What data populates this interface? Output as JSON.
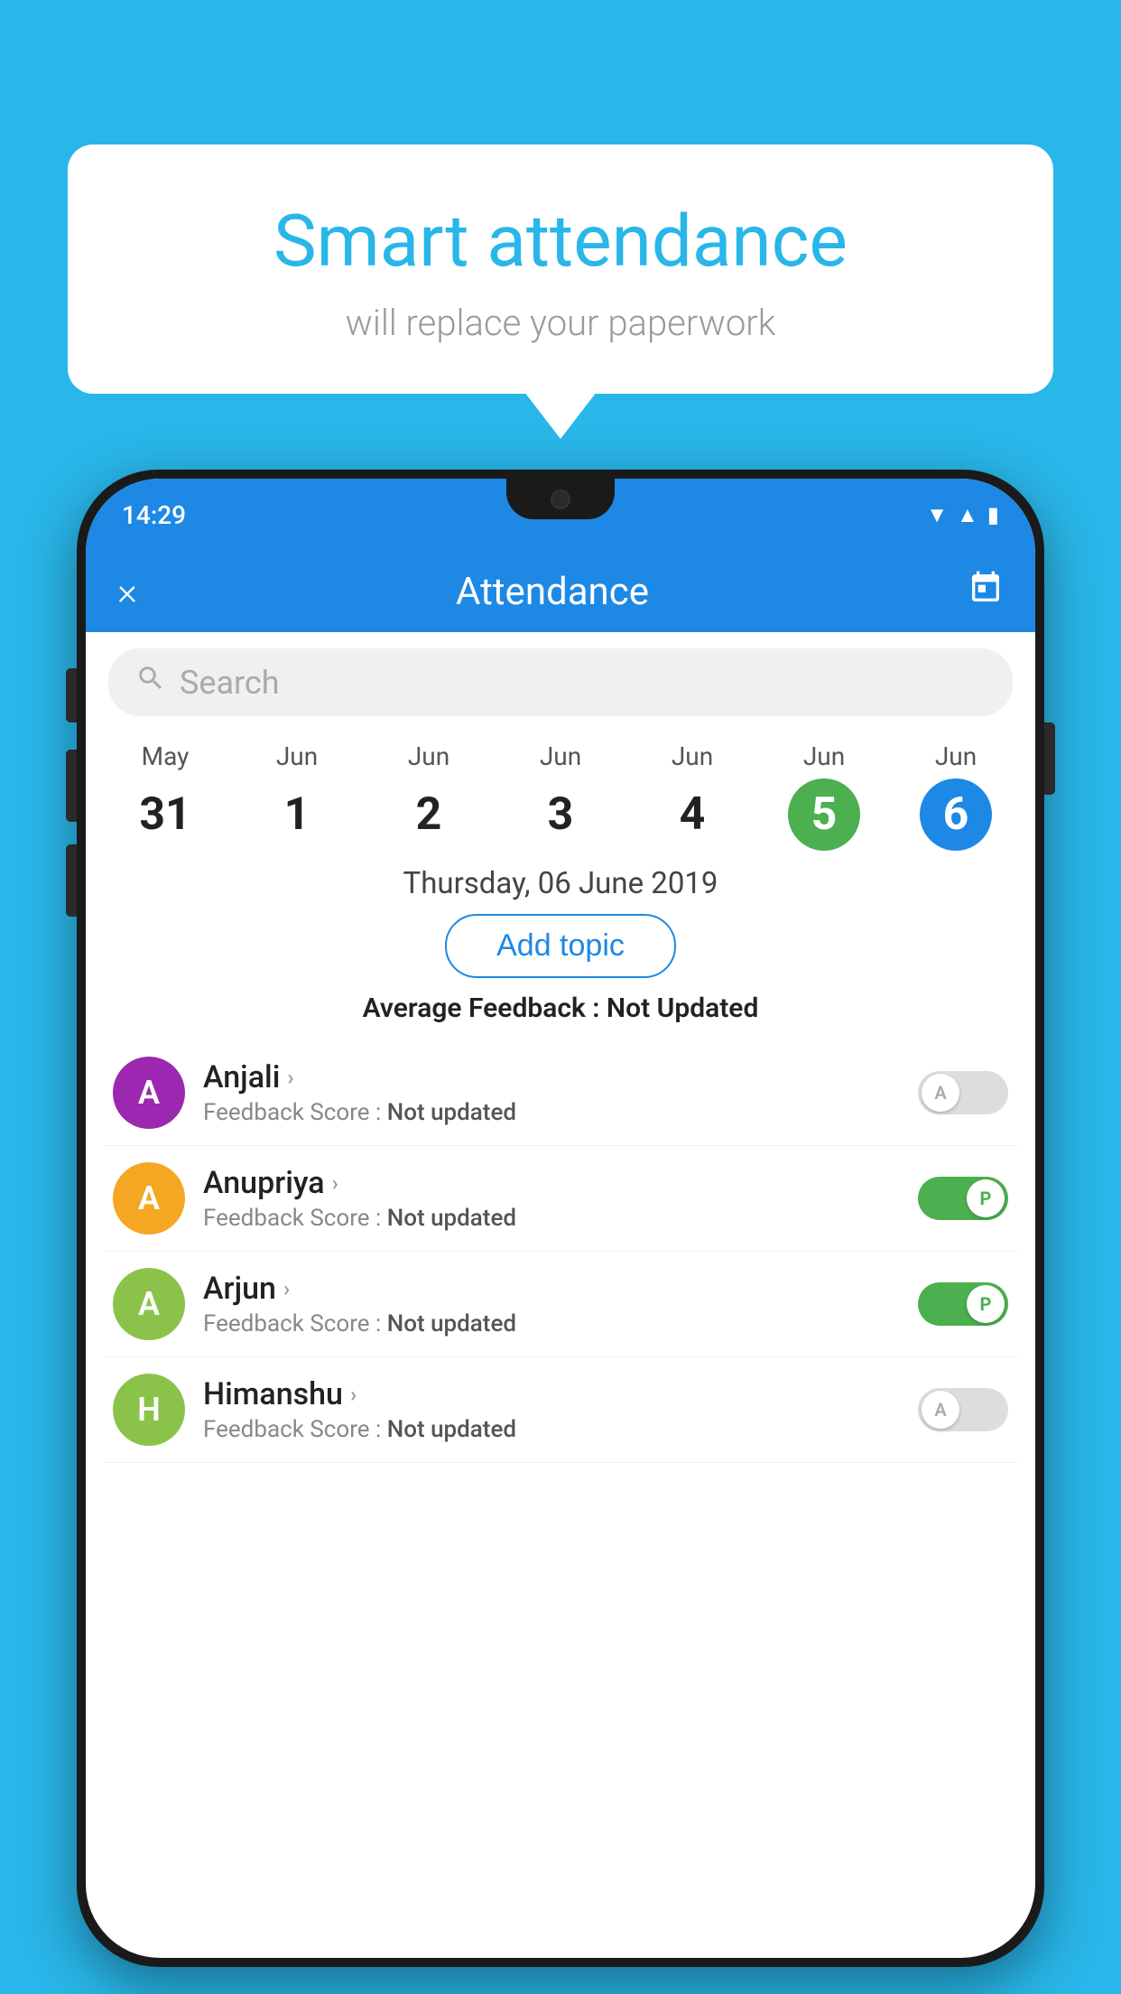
{
  "background_color": "#29b6e8",
  "bubble": {
    "title": "Smart attendance",
    "subtitle": "will replace your paperwork"
  },
  "status_bar": {
    "time": "14:29",
    "icons": [
      "wifi",
      "signal",
      "battery"
    ]
  },
  "header": {
    "title": "Attendance",
    "close_label": "×",
    "calendar_label": "📅"
  },
  "search": {
    "placeholder": "Search"
  },
  "date_strip": [
    {
      "month": "May",
      "day": "31",
      "style": "normal"
    },
    {
      "month": "Jun",
      "day": "1",
      "style": "normal"
    },
    {
      "month": "Jun",
      "day": "2",
      "style": "normal"
    },
    {
      "month": "Jun",
      "day": "3",
      "style": "normal"
    },
    {
      "month": "Jun",
      "day": "4",
      "style": "normal"
    },
    {
      "month": "Jun",
      "day": "5",
      "style": "green"
    },
    {
      "month": "Jun",
      "day": "6",
      "style": "blue"
    }
  ],
  "selected_date": "Thursday, 06 June 2019",
  "add_topic_label": "Add topic",
  "avg_feedback": {
    "label": "Average Feedback : ",
    "value": "Not Updated"
  },
  "students": [
    {
      "name": "Anjali",
      "avatar_letter": "A",
      "avatar_color": "#9c27b0",
      "feedback_label": "Feedback Score : ",
      "feedback_value": "Not updated",
      "attendance": "off",
      "toggle_letter": "A"
    },
    {
      "name": "Anupriya",
      "avatar_letter": "A",
      "avatar_color": "#f5a623",
      "feedback_label": "Feedback Score : ",
      "feedback_value": "Not updated",
      "attendance": "on",
      "toggle_letter": "P"
    },
    {
      "name": "Arjun",
      "avatar_letter": "A",
      "avatar_color": "#8bc34a",
      "feedback_label": "Feedback Score : ",
      "feedback_value": "Not updated",
      "attendance": "on",
      "toggle_letter": "P"
    },
    {
      "name": "Himanshu",
      "avatar_letter": "H",
      "avatar_color": "#8bc34a",
      "feedback_label": "Feedback Score : ",
      "feedback_value": "Not updated",
      "attendance": "off",
      "toggle_letter": "A"
    }
  ]
}
